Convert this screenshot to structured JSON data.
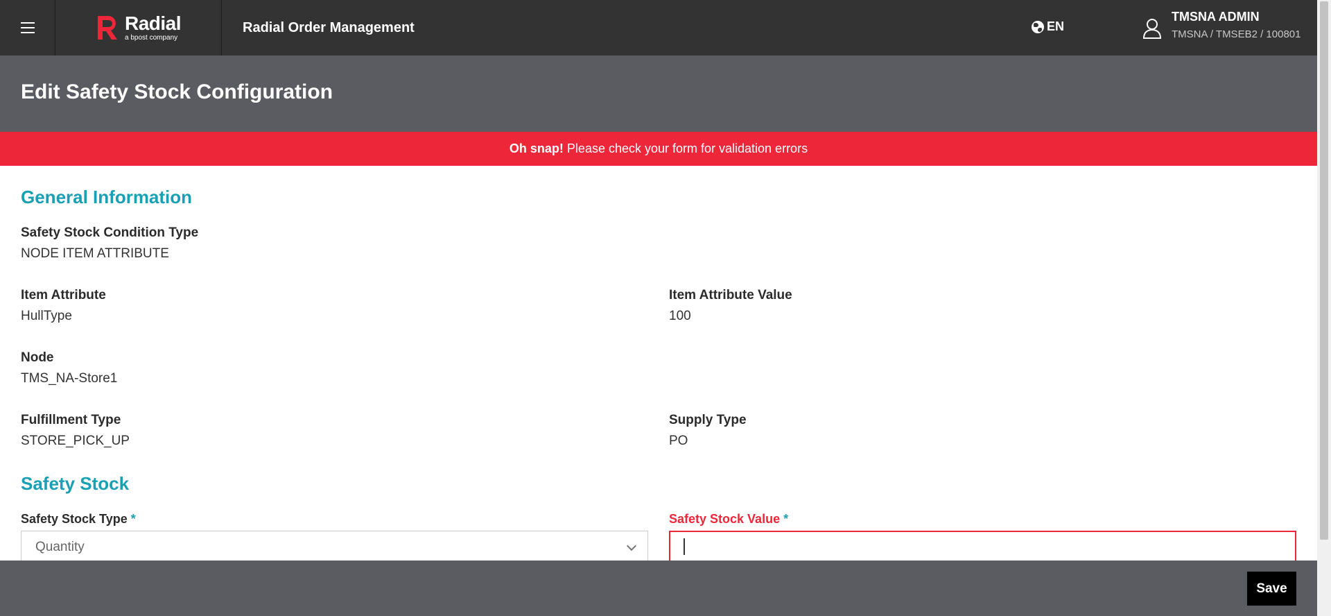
{
  "topbar": {
    "logo_name": "Radial",
    "logo_sub": "a bpost company",
    "app_title": "Radial Order Management",
    "language": "EN",
    "user_name": "TMSNA ADMIN",
    "user_context": "TMSNA / TMSEB2 / 100801"
  },
  "page": {
    "title": "Edit Safety Stock Configuration"
  },
  "alert": {
    "strong": "Oh snap!",
    "message": "Please check your form for validation errors"
  },
  "general": {
    "section_title": "General Information",
    "condition_type_label": "Safety Stock Condition Type",
    "condition_type_value": "NODE ITEM ATTRIBUTE",
    "item_attribute_label": "Item Attribute",
    "item_attribute_value": "HullType",
    "item_attribute_value_label": "Item Attribute Value",
    "item_attribute_value_value": "100",
    "node_label": "Node",
    "node_value": "TMS_NA-Store1",
    "fulfillment_type_label": "Fulfillment Type",
    "fulfillment_type_value": "STORE_PICK_UP",
    "supply_type_label": "Supply Type",
    "supply_type_value": "PO"
  },
  "safety_stock": {
    "section_title": "Safety Stock",
    "type_label": "Safety Stock Type",
    "type_value": "Quantity",
    "value_label": "Safety Stock Value",
    "value": "",
    "required_marker": "*"
  },
  "footer": {
    "save_label": "Save"
  },
  "colors": {
    "accent": "#1aa0b3",
    "error": "#ee263a",
    "topbar": "#333333",
    "header": "#5b5b62"
  }
}
